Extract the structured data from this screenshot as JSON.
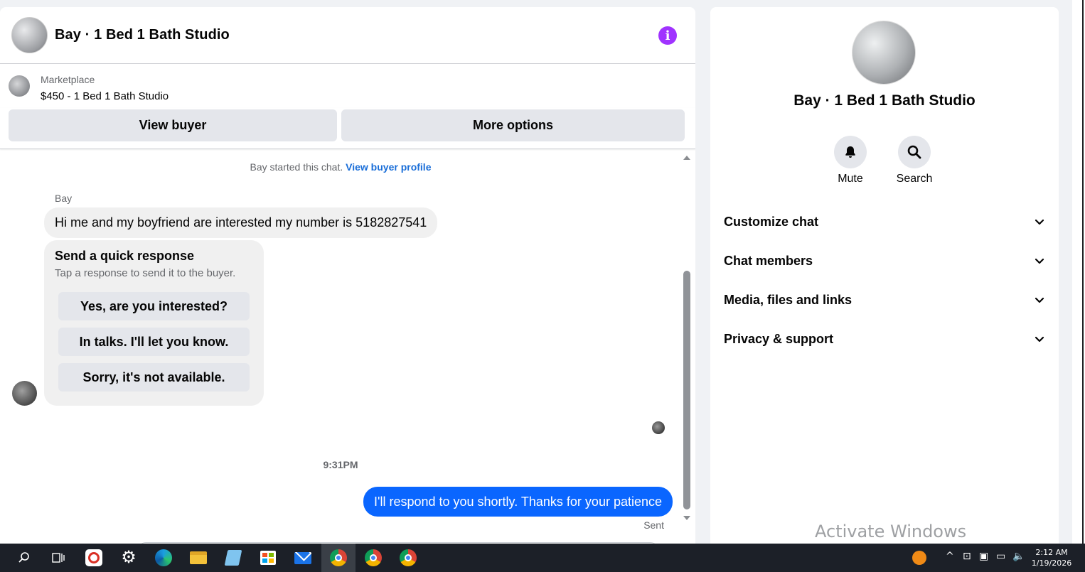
{
  "chat": {
    "title": "Bay · 1 Bed 1 Bath Studio",
    "listing_label": "Marketplace",
    "listing_name": "$450 - 1 Bed 1 Bath Studio",
    "view_buyer_label": "View buyer",
    "more_options_label": "More options",
    "started_text": "Bay started this chat.",
    "started_link": "View buyer profile",
    "sender_name": "Bay",
    "incoming_message": "Hi me and my boyfriend are interested my number is 5182827541",
    "quick_response": {
      "title": "Send a quick response",
      "subtitle": "Tap a response to send it to the buyer.",
      "options": [
        "Yes, are you interested?",
        "In talks. I'll let you know.",
        "Sorry, it's not available."
      ]
    },
    "timestamp": "9:31PM",
    "outgoing_message": "I'll respond to you shortly. Thanks for your patience",
    "sent_status": "Sent"
  },
  "side": {
    "title": "Bay · 1 Bed 1 Bath Studio",
    "mute_label": "Mute",
    "search_label": "Search",
    "sections": [
      "Customize chat",
      "Chat members",
      "Media, files and links",
      "Privacy & support"
    ],
    "watermark": "Activate Windows"
  },
  "taskbar": {
    "time": "2:12 AM",
    "date": "1/19/2026",
    "apps": [
      "search-icon",
      "task-view-icon",
      "red-app-icon",
      "settings-icon",
      "edge-icon",
      "file-explorer-icon",
      "notepad-icon",
      "store-icon",
      "mail-icon",
      "chrome-icon",
      "chrome-icon",
      "chrome-icon"
    ]
  },
  "colors": {
    "accent_blue": "#0a66ff",
    "link_blue": "#1a6ed8",
    "info_purple": "#a033ff"
  }
}
